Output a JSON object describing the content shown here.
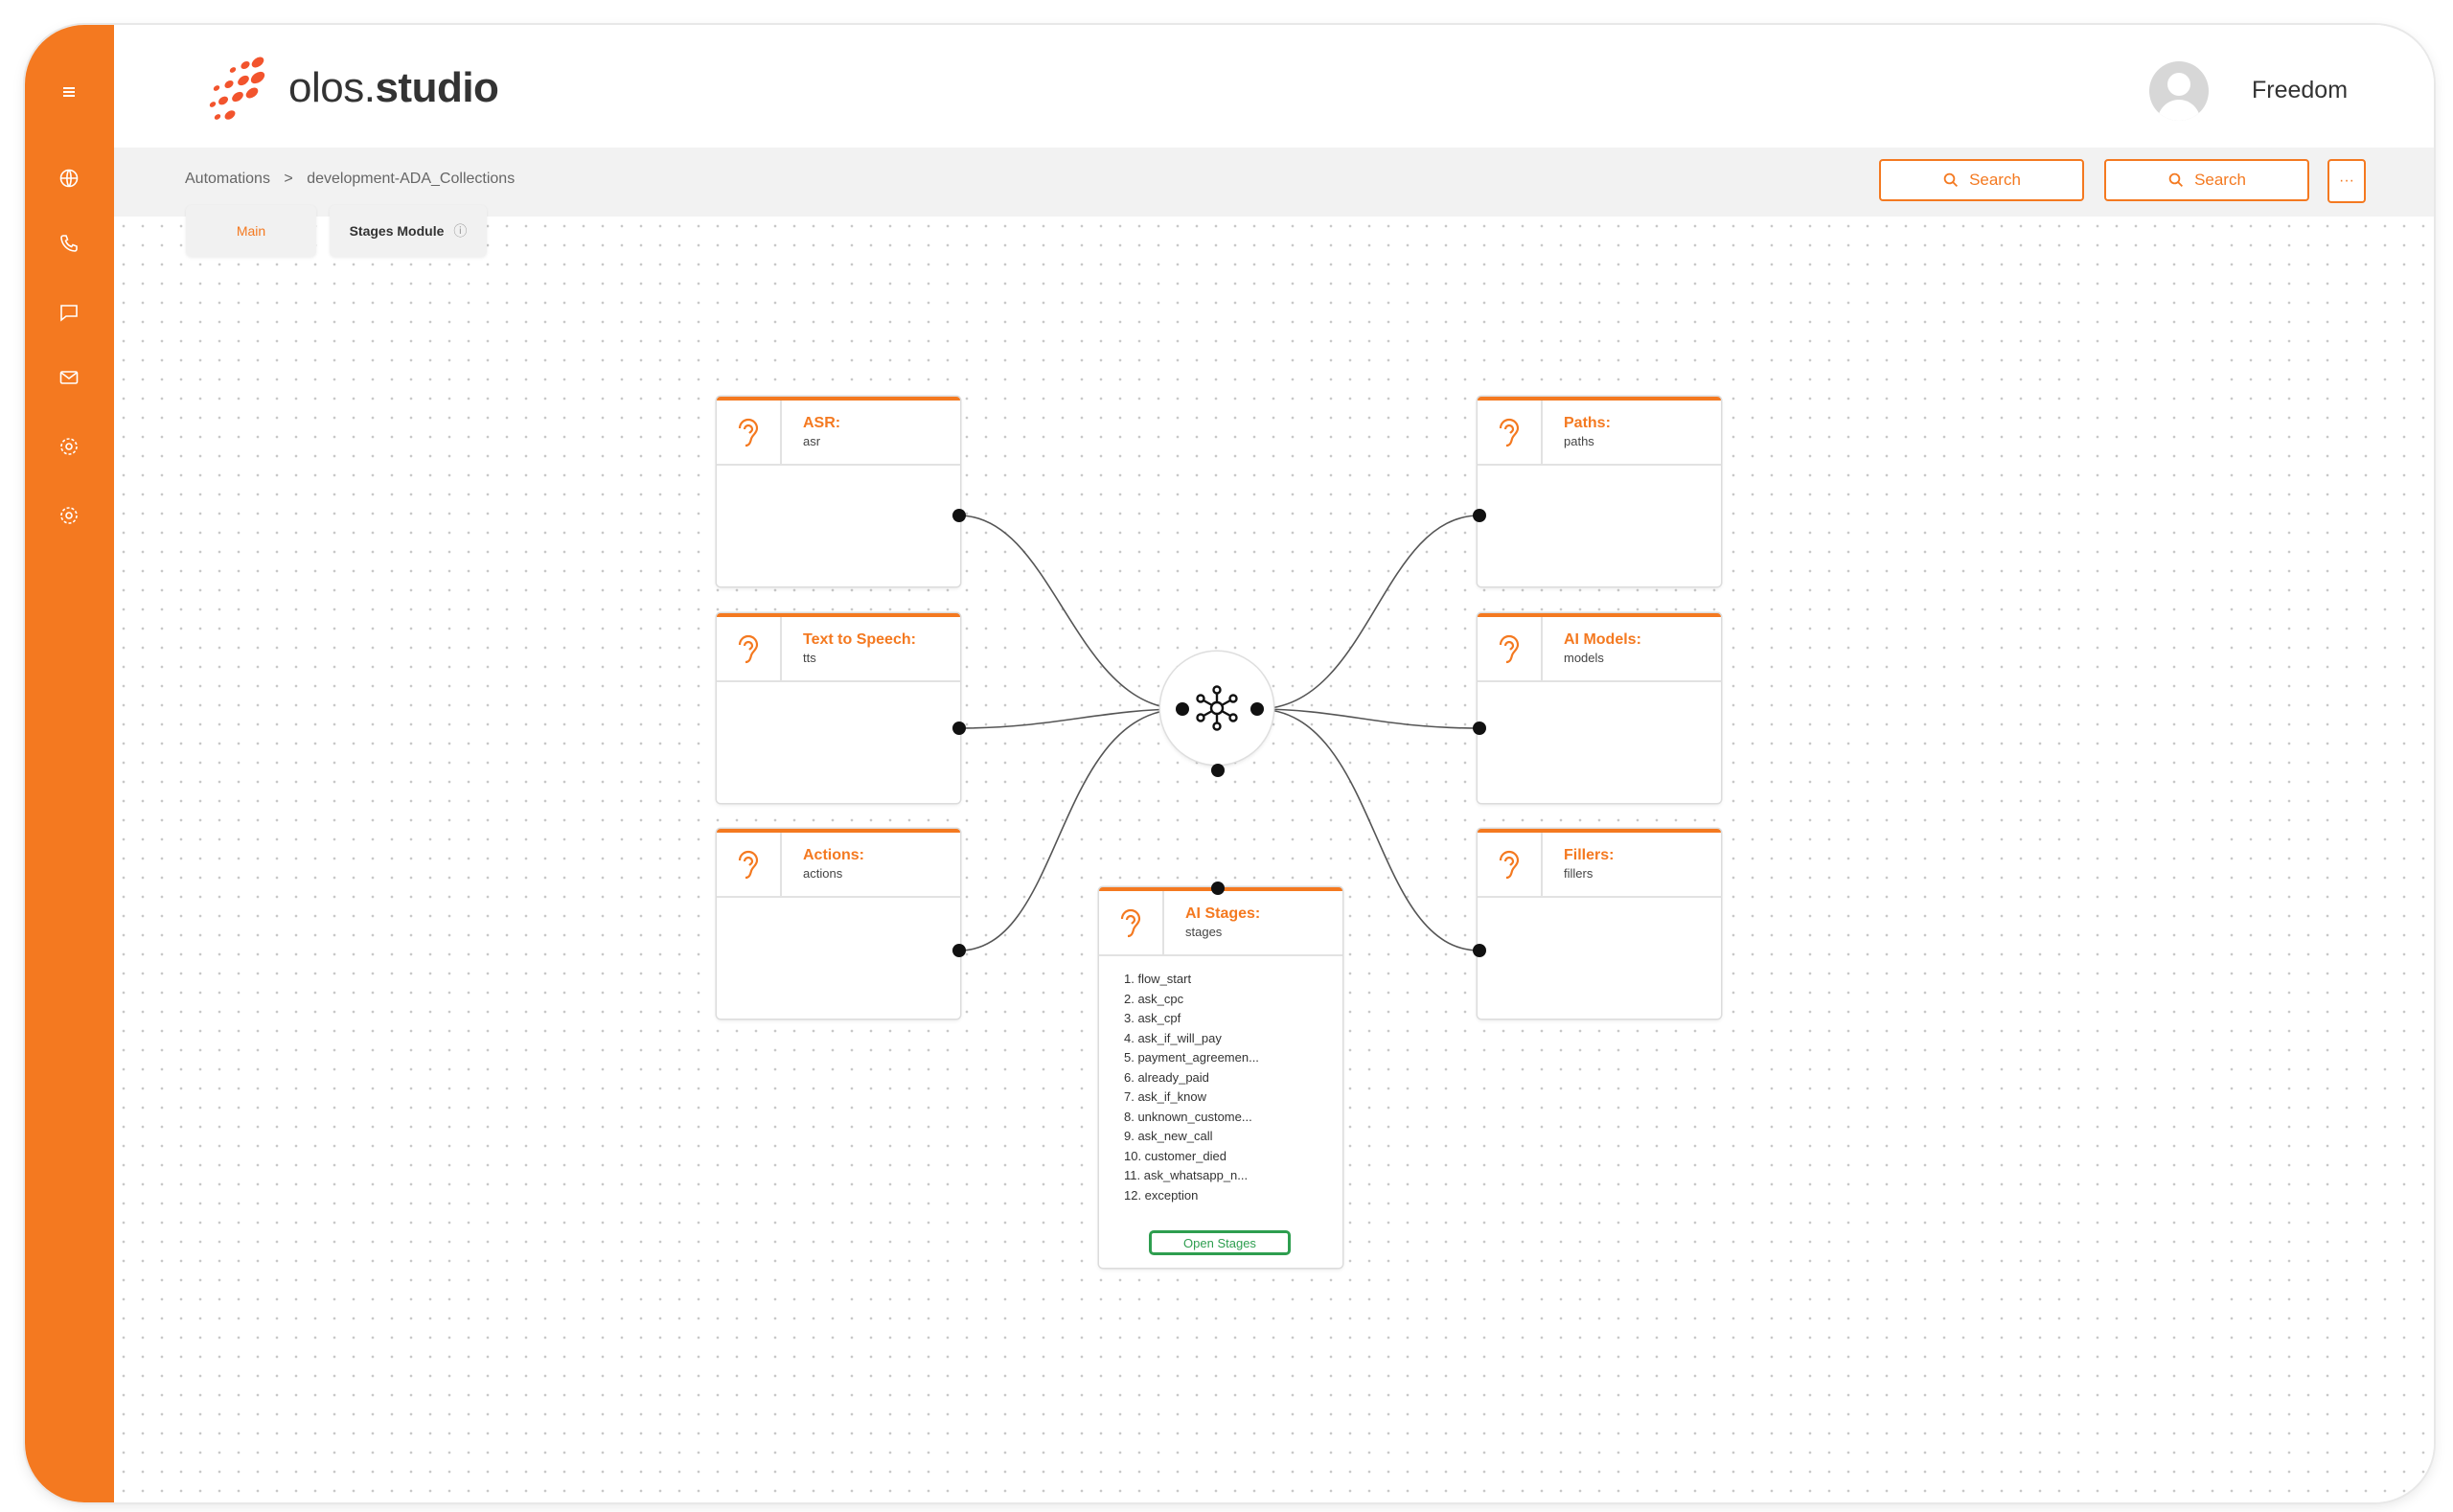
{
  "app": {
    "logo_text_light": "olos.",
    "logo_text_bold": "studio",
    "user_name": "Freedom"
  },
  "sidebar": {
    "items": [
      {
        "name": "menu",
        "icon": "hamburger-icon"
      },
      {
        "name": "web",
        "icon": "globe-icon"
      },
      {
        "name": "voice",
        "icon": "phone-icon"
      },
      {
        "name": "chat",
        "icon": "chat-icon"
      },
      {
        "name": "email",
        "icon": "mail-icon"
      },
      {
        "name": "settings",
        "icon": "gear-icon"
      },
      {
        "name": "settings-2",
        "icon": "gear-icon"
      }
    ]
  },
  "breadcrumb": {
    "root": "Automations",
    "separator": ">",
    "current": "development-ADA_Collections"
  },
  "toolbar": {
    "search_1": "Search",
    "search_2": "Search",
    "more": "···"
  },
  "tabs": [
    {
      "label": "Main"
    },
    {
      "label": "Stages Module",
      "info_icon": "ⓘ"
    }
  ],
  "nodes": {
    "asr": {
      "title": "ASR:",
      "subtitle": "asr",
      "icon": "ear-icon"
    },
    "tts": {
      "title": "Text to Speech:",
      "subtitle": "tts",
      "icon": "ear-icon"
    },
    "actions": {
      "title": "Actions:",
      "subtitle": "actions",
      "icon": "ear-icon"
    },
    "paths": {
      "title": "Paths:",
      "subtitle": "paths",
      "icon": "ear-icon"
    },
    "models": {
      "title": "AI Models:",
      "subtitle": "models",
      "icon": "ear-icon"
    },
    "fillers": {
      "title": "Fillers:",
      "subtitle": "fillers",
      "icon": "ear-icon"
    },
    "stages": {
      "title": "AI Stages:",
      "subtitle": "stages",
      "icon": "ear-icon",
      "items": [
        "1.  flow_start",
        "2.  ask_cpc",
        "3.  ask_cpf",
        "4.  ask_if_will_pay",
        "5.  payment_agreemen...",
        "6.  already_paid",
        "7.  ask_if_know",
        "8.  unknown_custome...",
        "9.  ask_new_call",
        "10.  customer_died",
        "11.  ask_whatsapp_n...",
        "12.  exception"
      ],
      "button": "Open Stages"
    }
  },
  "hub": {
    "icon": "network-hub-icon"
  },
  "colors": {
    "accent": "#f47920",
    "success": "#2e9e4f",
    "text": "#333333"
  }
}
